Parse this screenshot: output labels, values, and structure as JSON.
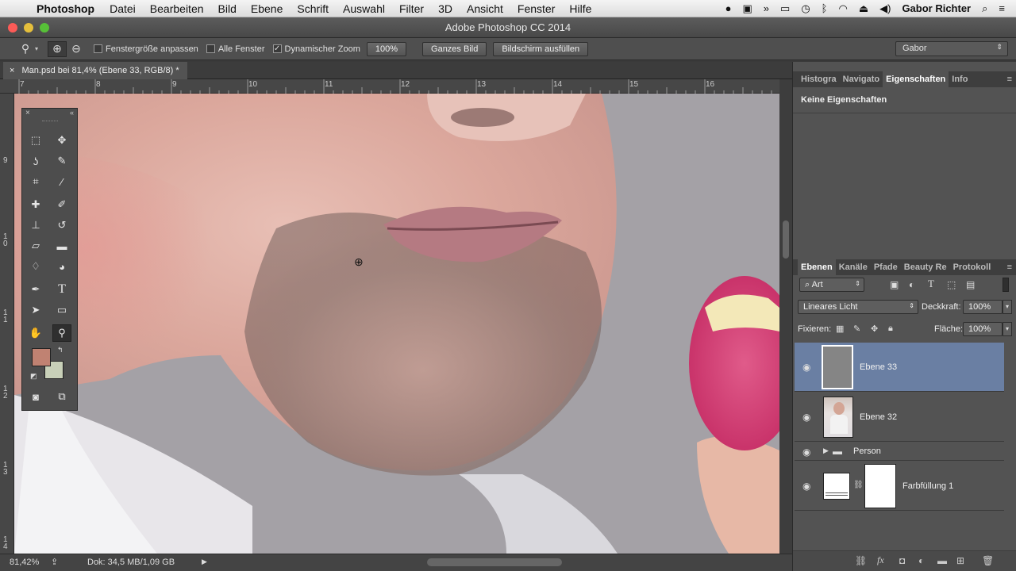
{
  "menubar": {
    "app": "Photoshop",
    "items": [
      "Datei",
      "Bearbeiten",
      "Bild",
      "Ebene",
      "Schrift",
      "Auswahl",
      "Filter",
      "3D",
      "Ansicht",
      "Fenster",
      "Hilfe"
    ],
    "user": "Gabor Richter"
  },
  "window": {
    "title": "Adobe Photoshop CC 2014"
  },
  "options": {
    "resize_windows": "Fenstergröße anpassen",
    "all_windows": "Alle Fenster",
    "scrubby_zoom": "Dynamischer Zoom",
    "zoom_100": "100%",
    "fit_screen": "Ganzes Bild",
    "fill_screen": "Bildschirm ausfüllen",
    "workspace": "Gabor"
  },
  "document": {
    "tab_title": "Man.psd bei 81,4% (Ebene 33, RGB/8) *"
  },
  "rulers": {
    "h": [
      "7",
      "8",
      "9",
      "10",
      "11",
      "12",
      "13",
      "14",
      "15",
      "16"
    ],
    "v": [
      "9",
      "1\n0",
      "1\n1",
      "1\n2",
      "1\n3",
      "1\n4"
    ]
  },
  "status": {
    "zoom": "81,42%",
    "doc": "Dok: 34,5 MB/1,09 GB"
  },
  "panels": {
    "top_tabs": [
      "Histogra",
      "Navigato",
      "Eigenschaften",
      "Info"
    ],
    "properties_text": "Keine Eigenschaften",
    "layer_tabs": [
      "Ebenen",
      "Kanäle",
      "Pfade",
      "Beauty Re",
      "Protokoll"
    ],
    "filter_kind": "Art",
    "blend_mode": "Lineares Licht",
    "opacity_label": "Deckkraft:",
    "opacity": "100%",
    "lock_label": "Fixieren:",
    "fill_label": "Fläche:",
    "fill": "100%",
    "layers": [
      {
        "name": "Ebene 33"
      },
      {
        "name": "Ebene 32"
      },
      {
        "name": "Person"
      },
      {
        "name": "Farbfüllung 1"
      }
    ]
  },
  "colors": {
    "foreground": "#c08272",
    "background": "#c8d0b8",
    "selected_layer": "#6a7fa3"
  }
}
